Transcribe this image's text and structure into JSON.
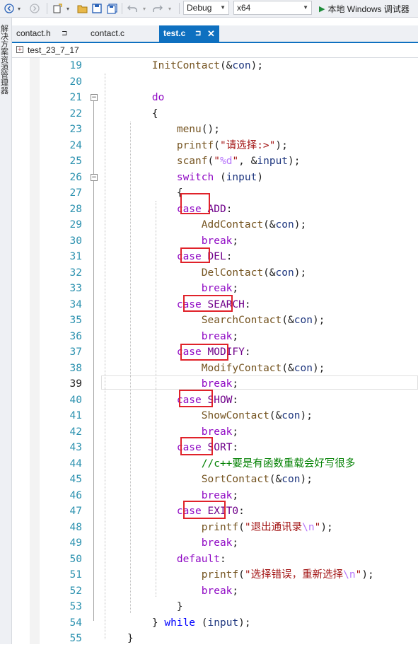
{
  "toolbar": {
    "config": "Debug",
    "platform": "x64",
    "run_label": "本地 Windows 调试器"
  },
  "side_strip": {
    "label": "解决方案资源管理器"
  },
  "tabs": [
    {
      "label": "contact.h",
      "pin": "⊐"
    },
    {
      "label": "contact.c"
    },
    {
      "label": "test.c",
      "pin": "⊐",
      "close": "✕"
    }
  ],
  "nav": {
    "scope": "test_23_7_17"
  },
  "editor": {
    "current_line": "39",
    "lines": [
      {
        "n": "19",
        "parts": [
          {
            "t": "    "
          },
          {
            "t": "InitContact",
            "c": "fn"
          },
          {
            "t": "(&"
          },
          {
            "t": "con",
            "c": "var"
          },
          {
            "t": ");"
          }
        ]
      },
      {
        "n": "20",
        "parts": []
      },
      {
        "n": "21",
        "parts": [
          {
            "t": "    "
          },
          {
            "t": "do",
            "c": "kw"
          }
        ]
      },
      {
        "n": "22",
        "parts": [
          {
            "t": "    {"
          }
        ]
      },
      {
        "n": "23",
        "parts": [
          {
            "t": "        "
          },
          {
            "t": "menu",
            "c": "fn"
          },
          {
            "t": "();"
          }
        ]
      },
      {
        "n": "24",
        "parts": [
          {
            "t": "        "
          },
          {
            "t": "printf",
            "c": "fn"
          },
          {
            "t": "("
          },
          {
            "t": "\"请选择:>\"",
            "c": "str"
          },
          {
            "t": ");"
          }
        ]
      },
      {
        "n": "25",
        "parts": [
          {
            "t": "        "
          },
          {
            "t": "scanf",
            "c": "fn"
          },
          {
            "t": "("
          },
          {
            "t": "\"",
            "c": "str"
          },
          {
            "t": "%d",
            "c": "esc"
          },
          {
            "t": "\"",
            "c": "str"
          },
          {
            "t": ", &"
          },
          {
            "t": "input",
            "c": "var"
          },
          {
            "t": ");"
          }
        ]
      },
      {
        "n": "26",
        "parts": [
          {
            "t": "        "
          },
          {
            "t": "switch",
            "c": "kw"
          },
          {
            "t": " ("
          },
          {
            "t": "input",
            "c": "var"
          },
          {
            "t": ")"
          }
        ]
      },
      {
        "n": "27",
        "parts": [
          {
            "t": "        {"
          }
        ]
      },
      {
        "n": "28",
        "parts": [
          {
            "t": "        "
          },
          {
            "t": "case",
            "c": "kw"
          },
          {
            "t": " "
          },
          {
            "t": "ADD",
            "c": "mac"
          },
          {
            "t": ":"
          }
        ]
      },
      {
        "n": "29",
        "parts": [
          {
            "t": "            "
          },
          {
            "t": "AddContact",
            "c": "fn"
          },
          {
            "t": "(&"
          },
          {
            "t": "con",
            "c": "var"
          },
          {
            "t": ");"
          }
        ]
      },
      {
        "n": "30",
        "parts": [
          {
            "t": "            "
          },
          {
            "t": "break",
            "c": "kw"
          },
          {
            "t": ";"
          }
        ]
      },
      {
        "n": "31",
        "parts": [
          {
            "t": "        "
          },
          {
            "t": "case",
            "c": "kw"
          },
          {
            "t": " "
          },
          {
            "t": "DEL",
            "c": "mac"
          },
          {
            "t": ":"
          }
        ]
      },
      {
        "n": "32",
        "parts": [
          {
            "t": "            "
          },
          {
            "t": "DelContact",
            "c": "fn"
          },
          {
            "t": "(&"
          },
          {
            "t": "con",
            "c": "var"
          },
          {
            "t": ");"
          }
        ]
      },
      {
        "n": "33",
        "parts": [
          {
            "t": "            "
          },
          {
            "t": "break",
            "c": "kw"
          },
          {
            "t": ";"
          }
        ]
      },
      {
        "n": "34",
        "parts": [
          {
            "t": "        "
          },
          {
            "t": "case",
            "c": "kw"
          },
          {
            "t": " "
          },
          {
            "t": "SEARCH",
            "c": "mac"
          },
          {
            "t": ":"
          }
        ]
      },
      {
        "n": "35",
        "parts": [
          {
            "t": "            "
          },
          {
            "t": "SearchContact",
            "c": "fn"
          },
          {
            "t": "(&"
          },
          {
            "t": "con",
            "c": "var"
          },
          {
            "t": ");"
          }
        ]
      },
      {
        "n": "36",
        "parts": [
          {
            "t": "            "
          },
          {
            "t": "break",
            "c": "kw"
          },
          {
            "t": ";"
          }
        ]
      },
      {
        "n": "37",
        "parts": [
          {
            "t": "        "
          },
          {
            "t": "case",
            "c": "kw"
          },
          {
            "t": " "
          },
          {
            "t": "MODIFY",
            "c": "mac"
          },
          {
            "t": ":"
          }
        ]
      },
      {
        "n": "38",
        "parts": [
          {
            "t": "            "
          },
          {
            "t": "ModifyContact",
            "c": "fn"
          },
          {
            "t": "(&"
          },
          {
            "t": "con",
            "c": "var"
          },
          {
            "t": ");"
          }
        ]
      },
      {
        "n": "39",
        "parts": [
          {
            "t": "            "
          },
          {
            "t": "break",
            "c": "kw"
          },
          {
            "t": ";"
          }
        ]
      },
      {
        "n": "40",
        "parts": [
          {
            "t": "        "
          },
          {
            "t": "case",
            "c": "kw"
          },
          {
            "t": " "
          },
          {
            "t": "SHOW",
            "c": "mac"
          },
          {
            "t": ":"
          }
        ]
      },
      {
        "n": "41",
        "parts": [
          {
            "t": "            "
          },
          {
            "t": "ShowContact",
            "c": "fn"
          },
          {
            "t": "(&"
          },
          {
            "t": "con",
            "c": "var"
          },
          {
            "t": ");"
          }
        ]
      },
      {
        "n": "42",
        "parts": [
          {
            "t": "            "
          },
          {
            "t": "break",
            "c": "kw"
          },
          {
            "t": ";"
          }
        ]
      },
      {
        "n": "43",
        "parts": [
          {
            "t": "        "
          },
          {
            "t": "case",
            "c": "kw"
          },
          {
            "t": " "
          },
          {
            "t": "SORT",
            "c": "mac"
          },
          {
            "t": ":"
          }
        ]
      },
      {
        "n": "44",
        "parts": [
          {
            "t": "            "
          },
          {
            "t": "//c++要是有函数重载会好写很多",
            "c": "cmt"
          }
        ]
      },
      {
        "n": "45",
        "parts": [
          {
            "t": "            "
          },
          {
            "t": "SortContact",
            "c": "fn"
          },
          {
            "t": "(&"
          },
          {
            "t": "con",
            "c": "var"
          },
          {
            "t": ");"
          }
        ]
      },
      {
        "n": "46",
        "parts": [
          {
            "t": "            "
          },
          {
            "t": "break",
            "c": "kw"
          },
          {
            "t": ";"
          }
        ]
      },
      {
        "n": "47",
        "parts": [
          {
            "t": "        "
          },
          {
            "t": "case",
            "c": "kw"
          },
          {
            "t": " "
          },
          {
            "t": "EXIT0",
            "c": "mac"
          },
          {
            "t": ":"
          }
        ]
      },
      {
        "n": "48",
        "parts": [
          {
            "t": "            "
          },
          {
            "t": "printf",
            "c": "fn"
          },
          {
            "t": "("
          },
          {
            "t": "\"退出通讯录",
            "c": "str"
          },
          {
            "t": "\\n",
            "c": "esc"
          },
          {
            "t": "\"",
            "c": "str"
          },
          {
            "t": ");"
          }
        ]
      },
      {
        "n": "49",
        "parts": [
          {
            "t": "            "
          },
          {
            "t": "break",
            "c": "kw"
          },
          {
            "t": ";"
          }
        ]
      },
      {
        "n": "50",
        "parts": [
          {
            "t": "        "
          },
          {
            "t": "default",
            "c": "kw"
          },
          {
            "t": ":"
          }
        ]
      },
      {
        "n": "51",
        "parts": [
          {
            "t": "            "
          },
          {
            "t": "printf",
            "c": "fn"
          },
          {
            "t": "("
          },
          {
            "t": "\"选择错误，重新选择",
            "c": "str"
          },
          {
            "t": "\\n",
            "c": "esc"
          },
          {
            "t": "\"",
            "c": "str"
          },
          {
            "t": ");"
          }
        ]
      },
      {
        "n": "52",
        "parts": [
          {
            "t": "            "
          },
          {
            "t": "break",
            "c": "kw"
          },
          {
            "t": ";"
          }
        ]
      },
      {
        "n": "53",
        "parts": [
          {
            "t": "        }"
          }
        ]
      },
      {
        "n": "54",
        "parts": [
          {
            "t": "    } "
          },
          {
            "t": "while",
            "c": "kwb"
          },
          {
            "t": " ("
          },
          {
            "t": "input",
            "c": "var"
          },
          {
            "t": ");"
          }
        ]
      },
      {
        "n": "55",
        "parts": [
          {
            "t": "}"
          }
        ]
      }
    ]
  },
  "colors": {
    "accent": "#0e70c0",
    "highlight_box": "#e0222a",
    "keyword": "#8f08c4",
    "line_number": "#2b91af"
  },
  "icons": [
    "back-arrow-icon",
    "forward-arrow-icon",
    "new-project-icon",
    "open-folder-icon",
    "save-icon",
    "save-all-icon",
    "undo-icon",
    "redo-icon",
    "play-icon"
  ]
}
